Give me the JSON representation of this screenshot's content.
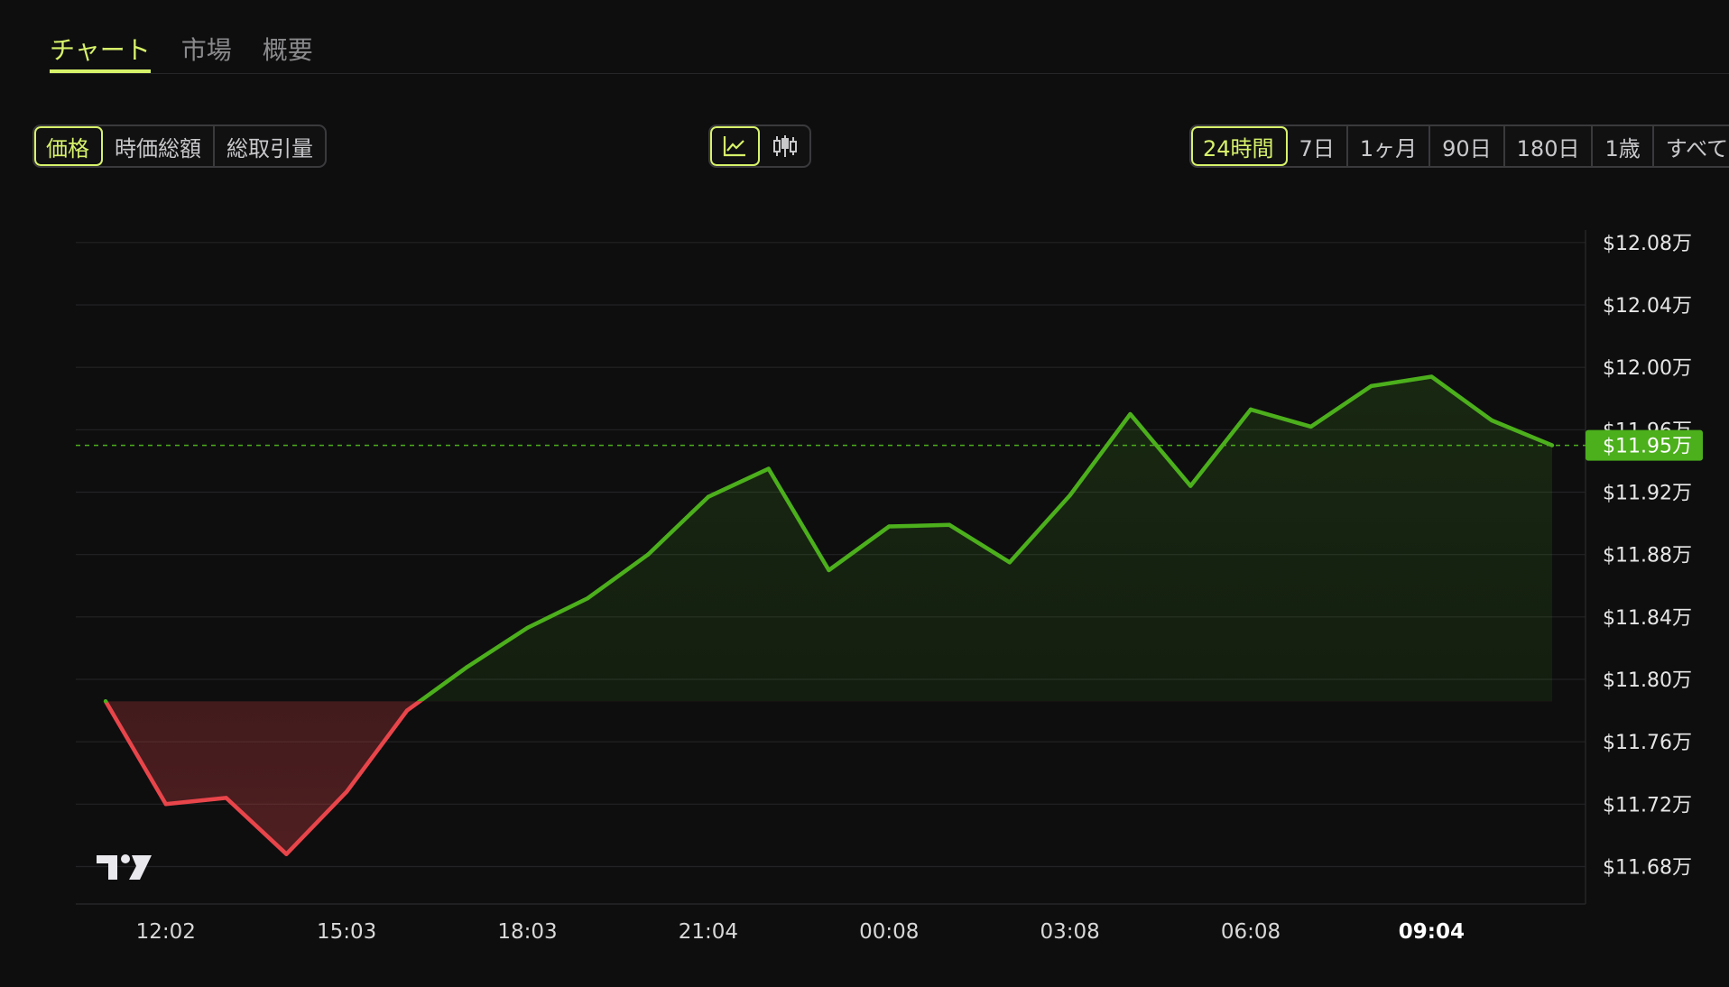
{
  "tabs": [
    {
      "label": "チャート",
      "active": true
    },
    {
      "label": "市場",
      "active": false
    },
    {
      "label": "概要",
      "active": false
    }
  ],
  "metric_buttons": [
    {
      "label": "価格",
      "active": true
    },
    {
      "label": "時価総額",
      "active": false
    },
    {
      "label": "総取引量",
      "active": false
    }
  ],
  "chart_type_buttons": [
    {
      "icon": "line-chart-icon",
      "active": true
    },
    {
      "icon": "candlestick-icon",
      "active": false
    }
  ],
  "range_buttons": [
    {
      "label": "24時間",
      "active": true
    },
    {
      "label": "7日",
      "active": false
    },
    {
      "label": "1ヶ月",
      "active": false
    },
    {
      "label": "90日",
      "active": false
    },
    {
      "label": "180日",
      "active": false
    },
    {
      "label": "1歳",
      "active": false
    },
    {
      "label": "すべて",
      "active": false
    }
  ],
  "colors": {
    "accent": "#d7f26a",
    "up": "#4caf1c",
    "down": "#e8454a",
    "background": "#0e0e0f"
  },
  "chart_data": {
    "type": "area",
    "y_tick_labels": [
      "$12.08万",
      "$12.04万",
      "$12.00万",
      "$11.96万",
      "$11.92万",
      "$11.88万",
      "$11.84万",
      "$11.80万",
      "$11.76万",
      "$11.72万",
      "$11.68万"
    ],
    "y_ticks": [
      120800,
      120400,
      120000,
      119600,
      119200,
      118800,
      118400,
      118000,
      117600,
      117200,
      116800
    ],
    "ylim": [
      116560,
      120880
    ],
    "x_tick_labels": [
      "12:02",
      "15:03",
      "18:03",
      "21:04",
      "00:08",
      "03:08",
      "06:08",
      "09:04"
    ],
    "x_tick_bold": "09:04",
    "baseline": 117860,
    "current_value": 119500,
    "current_label": "$11.95万",
    "grid": true,
    "series": [
      {
        "points": [
          [
            "10:30",
            117860
          ],
          [
            "12:00",
            117200
          ],
          [
            "13:30",
            117240
          ],
          [
            "15:00",
            116880
          ],
          [
            "16:30",
            117280
          ],
          [
            "18:00",
            117800
          ],
          [
            "19:30",
            118080
          ],
          [
            "21:00",
            118330
          ],
          [
            "22:30",
            118520
          ],
          [
            "00:00",
            118800
          ],
          [
            "01:30",
            119170
          ],
          [
            "03:00",
            119350
          ],
          [
            "04:30",
            118700
          ],
          [
            "06:00",
            118980
          ],
          [
            "07:30",
            118990
          ],
          [
            "09:00",
            118750
          ],
          [
            "10:30",
            119180
          ],
          [
            "12:00",
            119700
          ],
          [
            "13:30",
            119240
          ],
          [
            "15:00",
            119730
          ],
          [
            "16:30",
            119620
          ],
          [
            "18:00",
            119880
          ],
          [
            "19:30",
            119940
          ],
          [
            "21:00",
            119660
          ],
          [
            "22:30",
            119500
          ]
        ]
      }
    ]
  }
}
